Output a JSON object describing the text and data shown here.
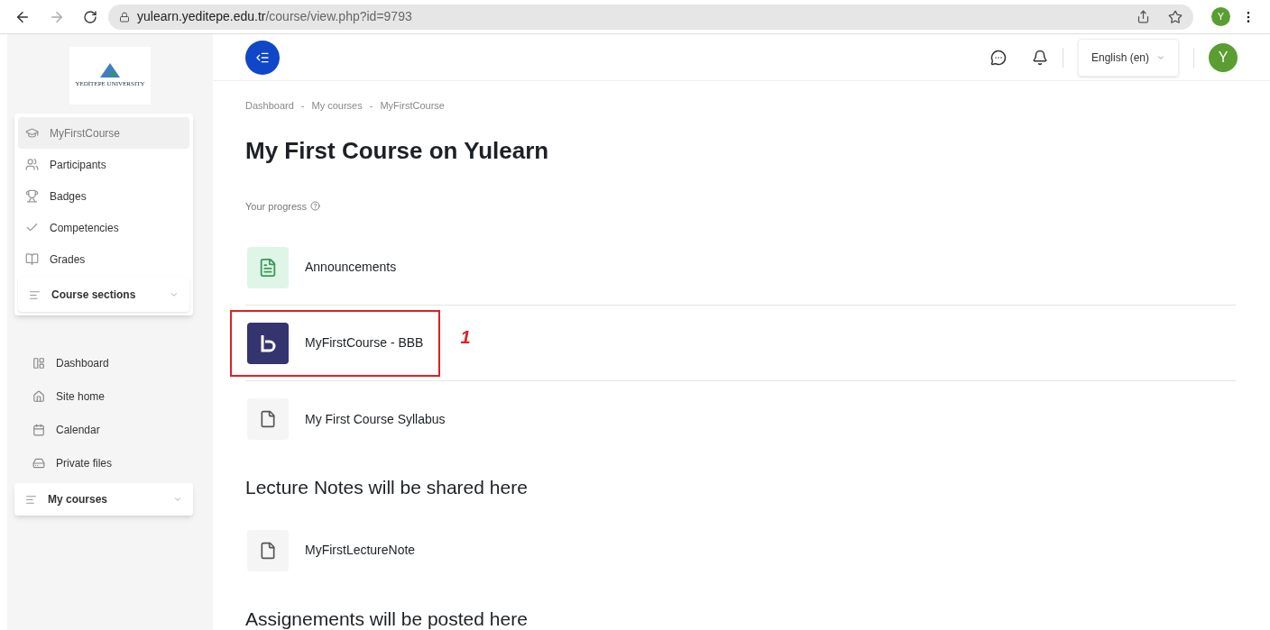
{
  "browser": {
    "url_host": "yulearn.yeditepe.edu.tr",
    "url_path": "/course/view.php?id=9793",
    "profile_initial": "Y"
  },
  "sidebar": {
    "logo_text": "YEDİTEPE UNIVERSITY",
    "course_items": [
      {
        "label": "MyFirstCourse",
        "selected": true
      },
      {
        "label": "Participants",
        "selected": false
      },
      {
        "label": "Badges",
        "selected": false
      },
      {
        "label": "Competencies",
        "selected": false
      },
      {
        "label": "Grades",
        "selected": false
      }
    ],
    "course_sections": "Course sections",
    "site_items": [
      {
        "label": "Dashboard"
      },
      {
        "label": "Site home"
      },
      {
        "label": "Calendar"
      },
      {
        "label": "Private files"
      }
    ],
    "my_courses": "My courses"
  },
  "header": {
    "language": "English (en)",
    "user_initial": "Y"
  },
  "breadcrumb": [
    {
      "label": "Dashboard"
    },
    {
      "separator": "-",
      "label": "My courses"
    },
    {
      "separator": "-",
      "label": "MyFirstCourse"
    }
  ],
  "title": "My First Course on Yulearn",
  "progress_label": "Your progress",
  "sections": [
    {
      "activities": [
        {
          "kind": "forum",
          "name": "Announcements",
          "highlighted": false
        },
        {
          "kind": "bbb",
          "name": "MyFirstCourse - BBB",
          "highlighted": true,
          "annotation": "1"
        },
        {
          "kind": "pdf",
          "name": "My First Course Syllabus",
          "highlighted": false
        }
      ]
    },
    {
      "title": "Lecture Notes will be shared here",
      "activities": [
        {
          "kind": "pdf",
          "name": "MyFirstLectureNote",
          "highlighted": false
        }
      ]
    },
    {
      "title": "Assignements will be posted here"
    }
  ]
}
